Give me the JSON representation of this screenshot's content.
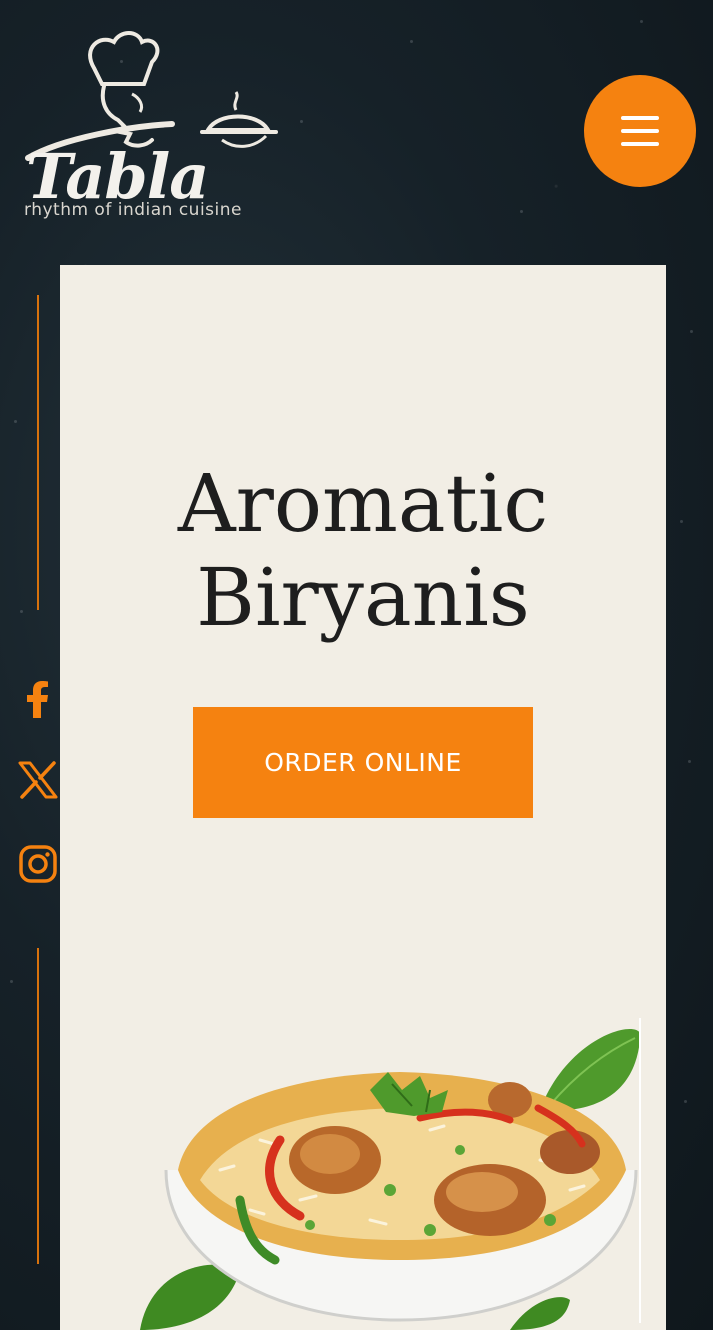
{
  "brand": {
    "name": "Tabla",
    "tagline": "rhythm of indian cuisine"
  },
  "header": {
    "menu_icon": "hamburger-menu-icon"
  },
  "social": {
    "items": [
      {
        "icon": "facebook-icon",
        "label": "Facebook"
      },
      {
        "icon": "x-twitter-icon",
        "label": "X"
      },
      {
        "icon": "instagram-icon",
        "label": "Instagram"
      }
    ],
    "accent_color": "#f58210"
  },
  "hero": {
    "title_line1": "Aromatic",
    "title_line2": "Biryanis",
    "cta_label": "ORDER ONLINE",
    "image": "biryani-bowl-image"
  },
  "colors": {
    "accent": "#f58210",
    "card_background": "#f2eee5",
    "page_background": "#162128",
    "title_text": "#1e1e1e"
  }
}
